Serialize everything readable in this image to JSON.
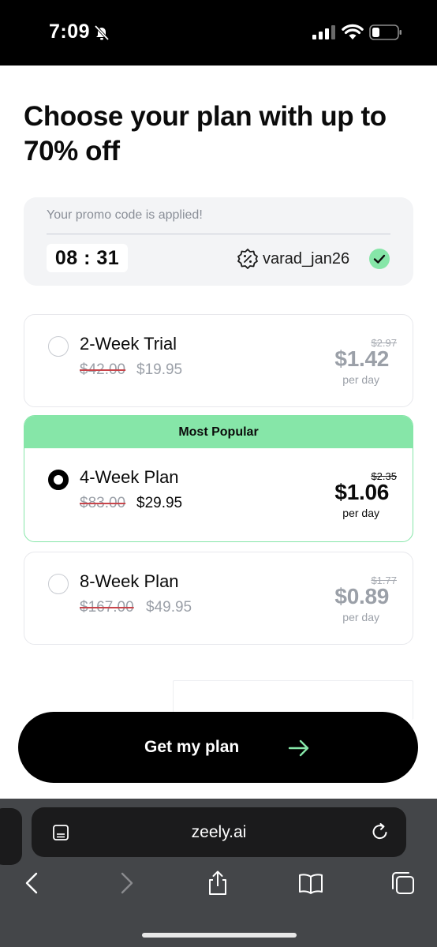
{
  "status_bar": {
    "time": "7:09"
  },
  "headline": "Choose your plan with up to 70% off",
  "promo": {
    "note": "Your promo code is applied!",
    "timer": "08 : 31",
    "code": "varad_jan26"
  },
  "badge": "Most Popular",
  "plans": [
    {
      "name": "2-Week Trial",
      "old_total": "$42.00",
      "new_total": "$19.95",
      "old_per_day": "$2.97",
      "per_day_price": "$1.42",
      "per_day_label": "per day",
      "selected": false
    },
    {
      "name": "4-Week Plan",
      "old_total": "$83.00",
      "new_total": "$29.95",
      "old_per_day": "$2.35",
      "per_day_price": "$1.06",
      "per_day_label": "per day",
      "selected": true
    },
    {
      "name": "8-Week Plan",
      "old_total": "$167.00",
      "new_total": "$49.95",
      "old_per_day": "$1.77",
      "per_day_price": "$0.89",
      "per_day_label": "per day",
      "selected": false
    }
  ],
  "cta": {
    "label": "Get my plan"
  },
  "browser": {
    "url": "zeely.ai"
  },
  "colors": {
    "accent": "#86e6a8",
    "strike": "#c8454b",
    "muted": "#9ba0a8",
    "cta": "#000000"
  },
  "icons": [
    "bell-slash-icon",
    "cellular-signal-icon",
    "wifi-icon",
    "battery-icon",
    "discount-badge-icon",
    "check-circle-icon",
    "arrow-right-icon",
    "reader-icon",
    "reload-icon",
    "back-icon",
    "forward-icon",
    "share-icon",
    "bookmarks-icon",
    "tabs-icon"
  ]
}
